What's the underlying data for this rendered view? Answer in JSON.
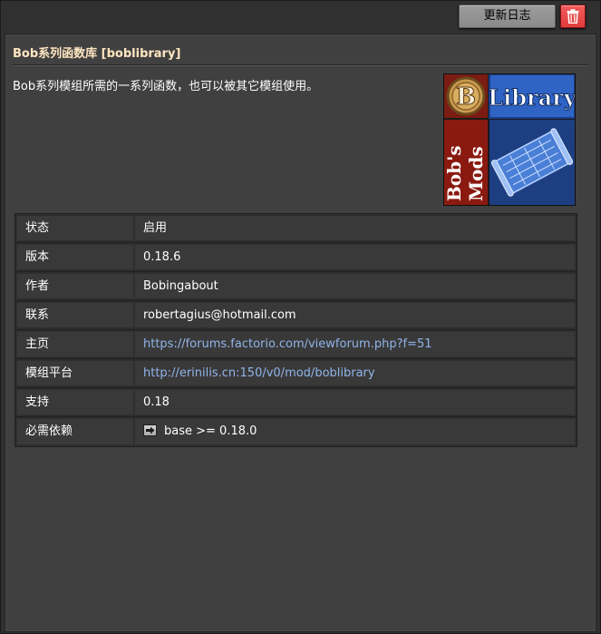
{
  "toolbar": {
    "changelog_label": "更新日志",
    "delete_icon": "trash-icon"
  },
  "mod": {
    "title": "Bob系列函数库 [boblibrary]",
    "description": "Bob系列模组所需的一系列函数，也可以被其它模组使用。",
    "thumbnail": {
      "library_text": "Library",
      "bobs_text": "Bob's",
      "mods_text": "Mods",
      "badge_letter": "B"
    }
  },
  "colors": {
    "title": "#ffe6c0",
    "link": "#8fb5e8",
    "delete": "#e03c3c"
  },
  "info": {
    "rows": [
      {
        "key": "状态",
        "value": "启用"
      },
      {
        "key": "版本",
        "value": "0.18.6"
      },
      {
        "key": "作者",
        "value": "Bobingabout"
      },
      {
        "key": "联系",
        "value": "robertagius@hotmail.com"
      },
      {
        "key": "主页",
        "value": "https://forums.factorio.com/viewforum.php?f=51"
      },
      {
        "key": "模组平台",
        "value": "http://erinilis.cn:150/v0/mod/boblibrary"
      },
      {
        "key": "支持",
        "value": "0.18"
      },
      {
        "key": "必需依赖",
        "value": "base >= 0.18.0"
      }
    ]
  }
}
